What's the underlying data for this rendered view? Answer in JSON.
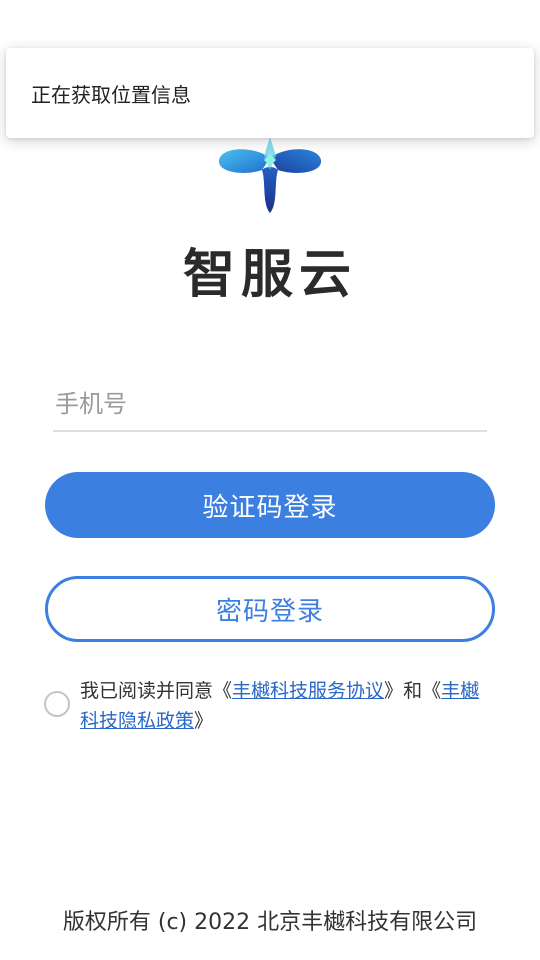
{
  "toast": {
    "message": "正在获取位置信息"
  },
  "brand": {
    "logo": "zhifuyun-logo-icon",
    "name": "智服云"
  },
  "login_form": {
    "phone_placeholder": "手机号",
    "phone_value": "",
    "sms_login_label": "验证码登录",
    "password_login_label": "密码登录"
  },
  "agreement": {
    "checked": false,
    "prefix": "我已阅读并同意",
    "open_quote_1": "《",
    "service_link": "丰樾科技服务协议",
    "close_quote_1": "》",
    "connector": "和",
    "open_quote_2": "《",
    "privacy_link": "丰樾科技隐私政策",
    "close_quote_2": "》"
  },
  "footer": {
    "copyright": "版权所有  (c) 2022 北京丰樾科技有限公司"
  },
  "colors": {
    "primary": "#3b7fe0",
    "link": "#2a68c8",
    "logo_dark": "#1e3fa8",
    "logo_light": "#3ab4e8",
    "logo_accent": "#7ff0e0"
  }
}
